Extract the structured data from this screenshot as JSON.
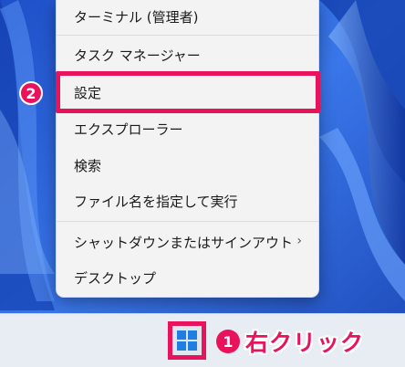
{
  "menu": {
    "items": [
      {
        "label": "ターミナル (管理者)",
        "has_submenu": false
      },
      {
        "label": "タスク マネージャー",
        "has_submenu": false
      },
      {
        "label": "設定",
        "has_submenu": false
      },
      {
        "label": "エクスプローラー",
        "has_submenu": false
      },
      {
        "label": "検索",
        "has_submenu": false
      },
      {
        "label": "ファイル名を指定して実行",
        "has_submenu": false
      },
      {
        "label": "シャットダウンまたはサインアウト",
        "has_submenu": true
      },
      {
        "label": "デスクトップ",
        "has_submenu": false
      }
    ],
    "submenu_arrow": "›"
  },
  "annotations": {
    "step1_number": "1",
    "step1_text": "右クリック",
    "step2_number": "2"
  },
  "taskbar": {
    "start_icon": "windows-logo-icon"
  },
  "colors": {
    "highlight": "#e8135a",
    "menu_background": "#f3f3f3",
    "wallpaper": "#2a5fd8",
    "taskbar": "#e8edf3",
    "windows_logo": "#1f7fe0"
  }
}
